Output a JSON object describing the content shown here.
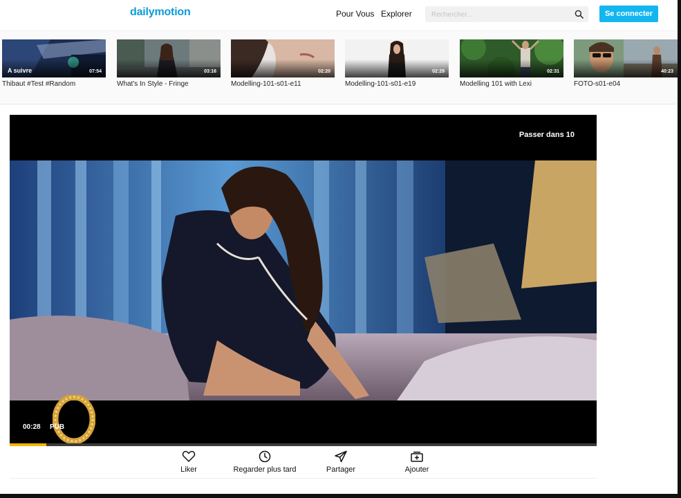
{
  "header": {
    "logo": "dailymotion",
    "nav": [
      "Pour Vous",
      "Explorer"
    ],
    "search_placeholder": "Rechercher...",
    "login_label": "Se connecter"
  },
  "strip": {
    "cards": [
      {
        "title": "Thibaut #Test #Random",
        "duration": "07:54",
        "badge": "A suivre"
      },
      {
        "title": "What's In Style - Fringe",
        "duration": "03:16"
      },
      {
        "title": "Modelling-101-s01-e11",
        "duration": "02:20"
      },
      {
        "title": "Modelling-101-s01-e19",
        "duration": "02:29"
      },
      {
        "title": "Modelling 101 with Lexi",
        "duration": "02:31"
      },
      {
        "title": "FOTO-s01-e04",
        "duration": "40:23"
      }
    ]
  },
  "player": {
    "skip_label": "Passer dans 10",
    "time": "00:28",
    "ad_label": "PUB",
    "progress": 0.063,
    "accent_color": "#f5b400"
  },
  "actions": {
    "like": "Liker",
    "watch_later": "Regarder plus tard",
    "share": "Partager",
    "add": "Ajouter"
  },
  "colors": {
    "brand": "#0d9bd8",
    "login_button": "#14b6f0"
  }
}
